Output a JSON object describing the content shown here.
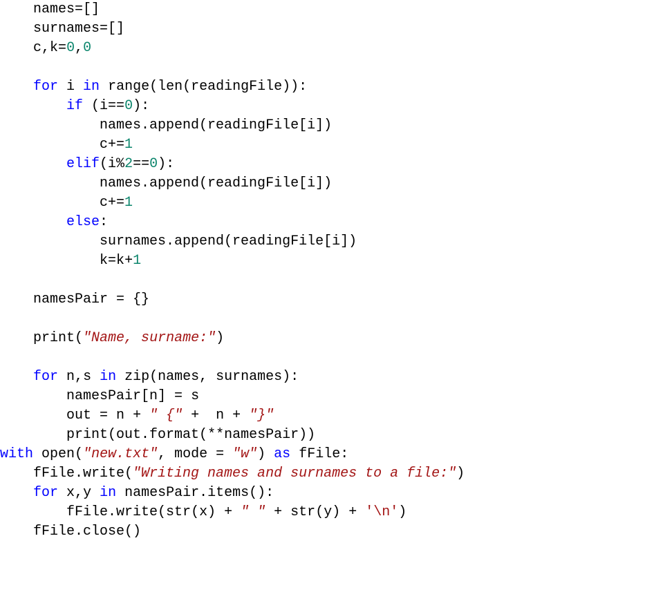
{
  "code": {
    "tokens": [
      [
        "    names",
        null
      ],
      [
        "=",
        null
      ],
      [
        "[]",
        null
      ],
      [
        "\n",
        null
      ],
      [
        "    surnames",
        null
      ],
      [
        "=",
        null
      ],
      [
        "[]",
        null
      ],
      [
        "\n",
        null
      ],
      [
        "    c",
        null
      ],
      [
        ",",
        null
      ],
      [
        "k",
        null
      ],
      [
        "=",
        null
      ],
      [
        "0",
        "num"
      ],
      [
        ",",
        null
      ],
      [
        "0",
        "num"
      ],
      [
        "\n",
        null
      ],
      [
        "\n",
        null
      ],
      [
        "    ",
        null
      ],
      [
        "for",
        "kw"
      ],
      [
        " i ",
        null
      ],
      [
        "in",
        "kw"
      ],
      [
        " ",
        null
      ],
      [
        "range",
        "func"
      ],
      [
        "(",
        null
      ],
      [
        "len",
        "func"
      ],
      [
        "(readingFile)):",
        null
      ],
      [
        "\n",
        null
      ],
      [
        "        ",
        null
      ],
      [
        "if",
        "kw"
      ],
      [
        " (i",
        null
      ],
      [
        "==",
        null
      ],
      [
        "0",
        "num"
      ],
      [
        "):",
        null
      ],
      [
        "\n",
        null
      ],
      [
        "            names.append(readingFile[i])",
        null
      ],
      [
        "\n",
        null
      ],
      [
        "            c",
        null
      ],
      [
        "+=",
        null
      ],
      [
        "1",
        "num"
      ],
      [
        "\n",
        null
      ],
      [
        "        ",
        null
      ],
      [
        "elif",
        "kw"
      ],
      [
        "(i",
        null
      ],
      [
        "%",
        null
      ],
      [
        "2",
        "num"
      ],
      [
        "==",
        null
      ],
      [
        "0",
        "num"
      ],
      [
        "):",
        null
      ],
      [
        "\n",
        null
      ],
      [
        "            names.append(readingFile[i])",
        null
      ],
      [
        "\n",
        null
      ],
      [
        "            c",
        null
      ],
      [
        "+=",
        null
      ],
      [
        "1",
        "num"
      ],
      [
        "\n",
        null
      ],
      [
        "        ",
        null
      ],
      [
        "else",
        "kw"
      ],
      [
        ":",
        null
      ],
      [
        "\n",
        null
      ],
      [
        "            surnames.append(readingFile[i])",
        null
      ],
      [
        "\n",
        null
      ],
      [
        "            k",
        null
      ],
      [
        "=",
        null
      ],
      [
        "k",
        null
      ],
      [
        "+",
        null
      ],
      [
        "1",
        "num"
      ],
      [
        "\n",
        null
      ],
      [
        "\n",
        null
      ],
      [
        "    namesPair ",
        null
      ],
      [
        "=",
        null
      ],
      [
        " {}",
        null
      ],
      [
        "\n",
        null
      ],
      [
        "\n",
        null
      ],
      [
        "    ",
        null
      ],
      [
        "print",
        "func"
      ],
      [
        "(",
        null
      ],
      [
        "\"Name, surname:\"",
        "str"
      ],
      [
        ")",
        null
      ],
      [
        "\n",
        null
      ],
      [
        "\n",
        null
      ],
      [
        "    ",
        null
      ],
      [
        "for",
        "kw"
      ],
      [
        " n",
        null
      ],
      [
        ",",
        null
      ],
      [
        "s ",
        null
      ],
      [
        "in",
        "kw"
      ],
      [
        " ",
        null
      ],
      [
        "zip",
        "func"
      ],
      [
        "(names, surnames):",
        null
      ],
      [
        "\n",
        null
      ],
      [
        "        namesPair[n] ",
        null
      ],
      [
        "=",
        null
      ],
      [
        " s",
        null
      ],
      [
        "\n",
        null
      ],
      [
        "        out ",
        null
      ],
      [
        "=",
        null
      ],
      [
        " n ",
        null
      ],
      [
        "+",
        null
      ],
      [
        " ",
        null
      ],
      [
        "\" {\"",
        "str"
      ],
      [
        " ",
        null
      ],
      [
        "+",
        null
      ],
      [
        "  n ",
        null
      ],
      [
        "+",
        null
      ],
      [
        " ",
        null
      ],
      [
        "\"}\"",
        "str"
      ],
      [
        "\n",
        null
      ],
      [
        "        ",
        null
      ],
      [
        "print",
        "func"
      ],
      [
        "(out.format(",
        null
      ],
      [
        "**",
        null
      ],
      [
        "namesPair))",
        null
      ],
      [
        "\n",
        null
      ],
      [
        "with",
        "kw"
      ],
      [
        " ",
        null
      ],
      [
        "open",
        "func"
      ],
      [
        "(",
        null
      ],
      [
        "\"new.txt\"",
        "str"
      ],
      [
        ", mode ",
        null
      ],
      [
        "=",
        null
      ],
      [
        " ",
        null
      ],
      [
        "\"w\"",
        "str"
      ],
      [
        ") ",
        null
      ],
      [
        "as",
        "kw"
      ],
      [
        " fFile:",
        null
      ],
      [
        "\n",
        null
      ],
      [
        "    fFile.write(",
        null
      ],
      [
        "\"Writing names and surnames to a file:\"",
        "str"
      ],
      [
        ")",
        null
      ],
      [
        "\n",
        null
      ],
      [
        "    ",
        null
      ],
      [
        "for",
        "kw"
      ],
      [
        " x",
        null
      ],
      [
        ",",
        null
      ],
      [
        "y ",
        null
      ],
      [
        "in",
        "kw"
      ],
      [
        " namesPair.items():",
        null
      ],
      [
        "\n",
        null
      ],
      [
        "        fFile.write(",
        null
      ],
      [
        "str",
        "func"
      ],
      [
        "(x) ",
        null
      ],
      [
        "+",
        null
      ],
      [
        " ",
        null
      ],
      [
        "\" \"",
        "str"
      ],
      [
        " ",
        null
      ],
      [
        "+",
        null
      ],
      [
        " ",
        null
      ],
      [
        "str",
        "func"
      ],
      [
        "(y) ",
        null
      ],
      [
        "+",
        null
      ],
      [
        " ",
        null
      ],
      [
        "'\\n'",
        "strn"
      ],
      [
        ")",
        null
      ],
      [
        "\n",
        null
      ],
      [
        "    fFile.close()",
        null
      ]
    ]
  }
}
